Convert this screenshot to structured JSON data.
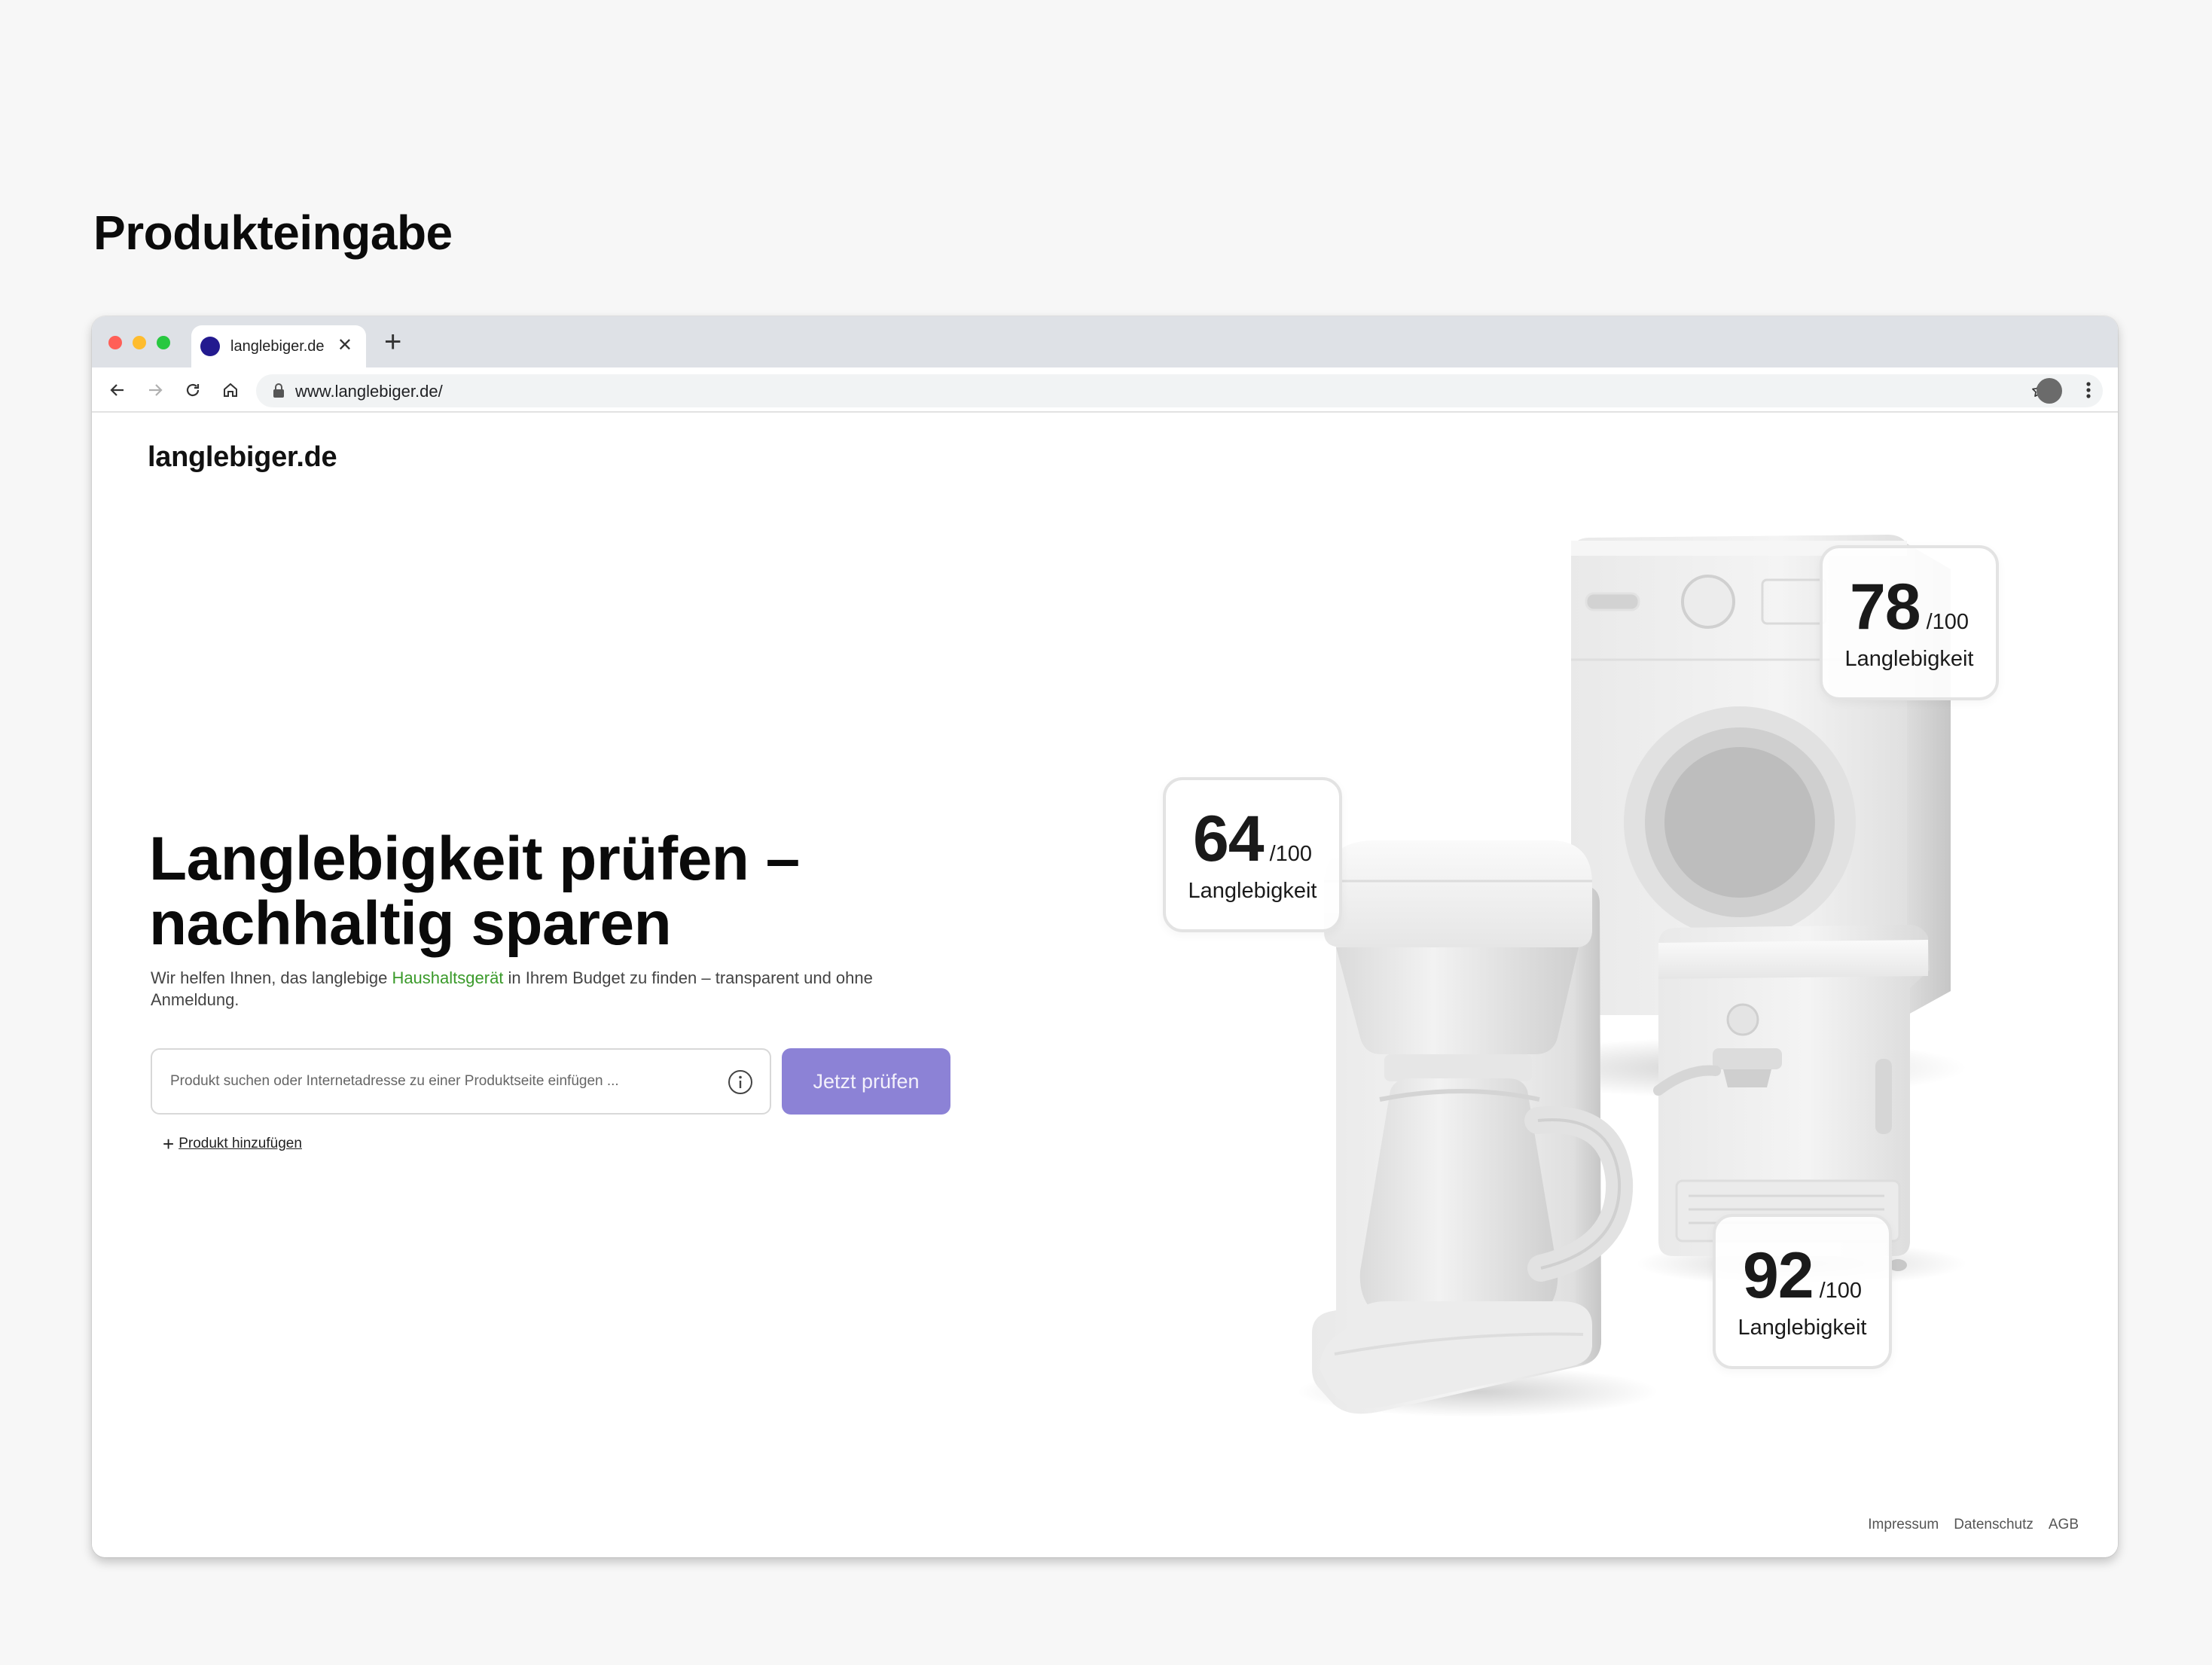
{
  "page": {
    "heading": "Produkteingabe"
  },
  "browser": {
    "tab": {
      "title": "langlebiger.de",
      "close": "✕",
      "new_tab": "+"
    },
    "address_bar": {
      "url": "www.langlebiger.de/"
    }
  },
  "site": {
    "logo": "langlebiger.de",
    "hero": {
      "title_line1": "Langlebigkeit prüfen –",
      "title_line2": "nachhaltig sparen",
      "subtitle_before": "Wir helfen Ihnen, das langlebige ",
      "subtitle_accent": "Haushaltsgerät",
      "subtitle_after": " in Ihrem Budget zu finden – transparent und ohne Anmeldung."
    },
    "search": {
      "placeholder": "Produkt suchen oder Internetadresse zu einer Produktseite einfügen ...",
      "value": "",
      "submit_label": "Jetzt prüfen"
    },
    "add_product": {
      "icon": "+",
      "label": "Produkt hinzufügen"
    },
    "score_cards": [
      {
        "score": "78",
        "max": "/100",
        "label": "Langlebigkeit"
      },
      {
        "score": "64",
        "max": "/100",
        "label": "Langlebigkeit"
      },
      {
        "score": "92",
        "max": "/100",
        "label": "Langlebigkeit"
      }
    ],
    "footer": {
      "links": [
        "Impressum",
        "Datenschutz",
        "AGB"
      ]
    }
  },
  "colors": {
    "cta": "#8c82d6",
    "accent_text": "#3a9a2a",
    "favicon": "#231a8f",
    "chrome": "#dee1e6",
    "page_bg": "#f7f7f7"
  }
}
